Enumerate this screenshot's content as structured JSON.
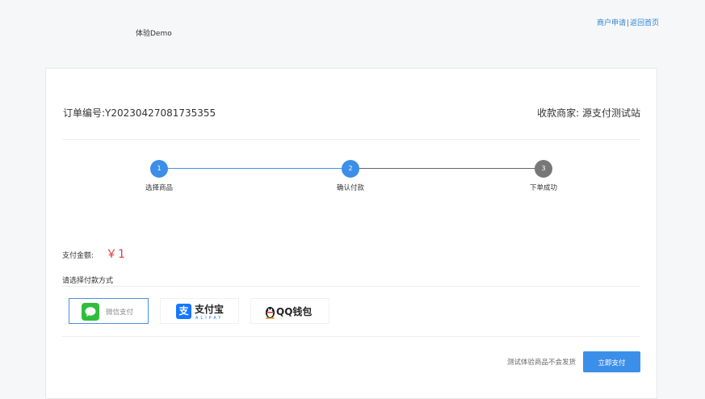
{
  "header": {
    "brand": "体验Demo",
    "links": {
      "apply": "商户申请",
      "separator": "|",
      "home": "返回首页"
    }
  },
  "order": {
    "label_number": "订单编号:",
    "number": "Y20230427081735355",
    "merchant_label": "收款商家:",
    "merchant_name": "源支付测试站"
  },
  "steps": [
    {
      "num": "1",
      "label": "选择商品",
      "state": "done"
    },
    {
      "num": "2",
      "label": "确认付款",
      "state": "current"
    },
    {
      "num": "3",
      "label": "下单成功",
      "state": "todo"
    }
  ],
  "payment": {
    "amount_label": "支付金额:",
    "amount_value": "￥1",
    "choose_label": "请选择付款方式",
    "methods": {
      "wechat": {
        "label": "微信支付",
        "icon": "wechat-icon",
        "selected": true
      },
      "alipay": {
        "label": "支付宝",
        "sub": "ALIPAY",
        "glyph": "支",
        "icon": "alipay-icon"
      },
      "qq": {
        "label": "QQ钱包",
        "icon": "qq-penguin-icon"
      }
    },
    "note": "测试体验商品不会发货",
    "pay_button": "立即支付"
  },
  "colors": {
    "accent": "#3c8fe8",
    "price": "#e03c3c",
    "wechat": "#2fbe3c",
    "alipay": "#1677ff"
  }
}
